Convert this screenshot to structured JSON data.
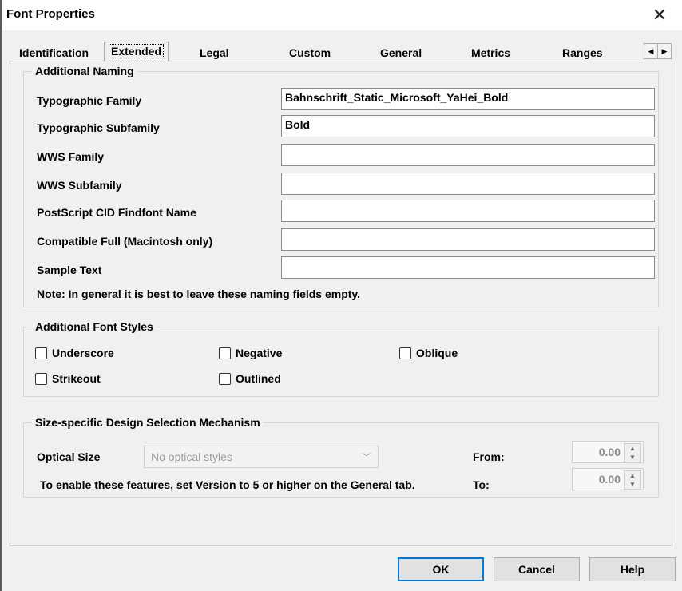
{
  "window": {
    "title": "Font Properties"
  },
  "tabs": [
    "Identification",
    "Extended",
    "Legal",
    "Custom",
    "General",
    "Metrics",
    "Ranges"
  ],
  "additional_naming": {
    "legend": "Additional Naming",
    "fields": [
      {
        "label": "Typographic Family",
        "value": "Bahnschrift_Static_Microsoft_YaHei_Bold"
      },
      {
        "label": "Typographic Subfamily",
        "value": "Bold"
      },
      {
        "label": "WWS Family",
        "value": ""
      },
      {
        "label": "WWS Subfamily",
        "value": ""
      },
      {
        "label": "PostScript CID Findfont Name",
        "value": ""
      },
      {
        "label": "Compatible Full (Macintosh only)",
        "value": ""
      },
      {
        "label": "Sample Text",
        "value": ""
      }
    ],
    "note": "Note: In general it is best to leave these naming fields empty."
  },
  "additional_styles": {
    "legend": "Additional Font Styles",
    "checkboxes": [
      {
        "label": "Underscore",
        "checked": false
      },
      {
        "label": "Negative",
        "checked": false
      },
      {
        "label": "Oblique",
        "checked": false
      },
      {
        "label": "Strikeout",
        "checked": false
      },
      {
        "label": "Outlined",
        "checked": false
      }
    ]
  },
  "size_specific": {
    "legend": "Size-specific Design Selection Mechanism",
    "optical_size_label": "Optical Size",
    "optical_size_value": "No optical styles",
    "from_label": "From:",
    "from_value": "0.00",
    "to_label": "To:",
    "to_value": "0.00",
    "hint": "To enable these features, set Version to 5 or higher on the General tab."
  },
  "buttons": {
    "ok": "OK",
    "cancel": "Cancel",
    "help": "Help"
  }
}
